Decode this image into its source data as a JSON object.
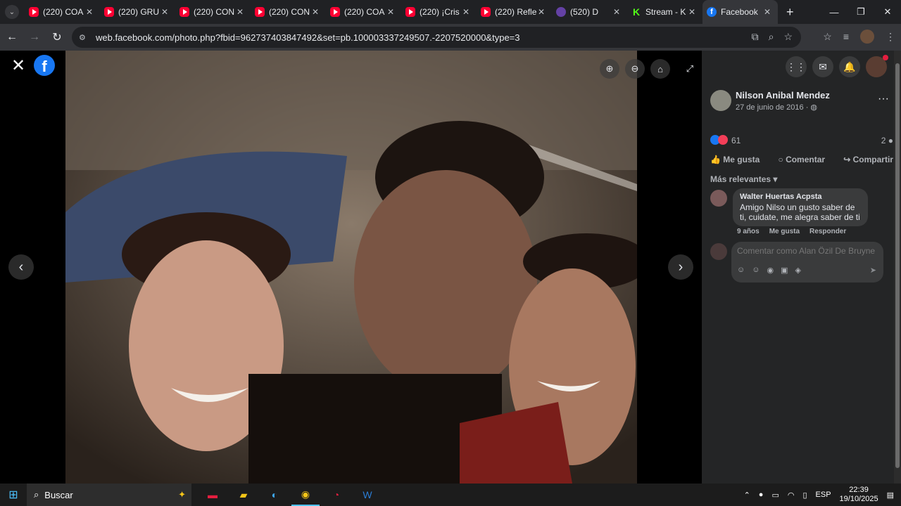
{
  "browser": {
    "tabs": [
      {
        "title": "(220) COA",
        "favicon": "youtube-icon"
      },
      {
        "title": "(220) GRU",
        "favicon": "youtube-icon"
      },
      {
        "title": "(220) CON",
        "favicon": "youtube-icon"
      },
      {
        "title": "(220) CON",
        "favicon": "youtube-icon"
      },
      {
        "title": "(220) COA",
        "favicon": "youtube-icon"
      },
      {
        "title": "(220) ¡Cris",
        "favicon": "youtube-icon"
      },
      {
        "title": "(220) Refle",
        "favicon": "youtube-icon"
      },
      {
        "title": "(520) D",
        "favicon": "twitch-icon"
      },
      {
        "title": "Stream - K",
        "favicon": "kick-icon"
      },
      {
        "title": "Facebook",
        "favicon": "facebook-icon",
        "active": true
      }
    ],
    "url": "web.facebook.com/photo.php?fbid=962737403847492&set=pb.100003337249507.-2207520000&type=3"
  },
  "post": {
    "author": "Nilson Anibal Mendez",
    "date": "27 de junio de 2016 · ",
    "reaction_count": "61",
    "comment_count": "2",
    "actions": {
      "like": "Me gusta",
      "comment": "Comentar",
      "share": "Compartir"
    },
    "sort_label": "Más relevantes ▾"
  },
  "comments": [
    {
      "author": "Walter Huertas Acpsta",
      "text": "Amigo Nilso un gusto saber de ti, cuidate, me alegra saber de ti",
      "age": "9 años",
      "like": "Me gusta",
      "reply": "Responder"
    }
  ],
  "compose": {
    "placeholder": "Comentar como Alan Özil De Bruyne"
  },
  "taskbar": {
    "search": "Buscar",
    "lang": "ESP",
    "time": "22:39",
    "date": "19/10/2025"
  },
  "colors": {
    "facebook_blue": "#1877f2",
    "panel_bg": "#242526"
  }
}
